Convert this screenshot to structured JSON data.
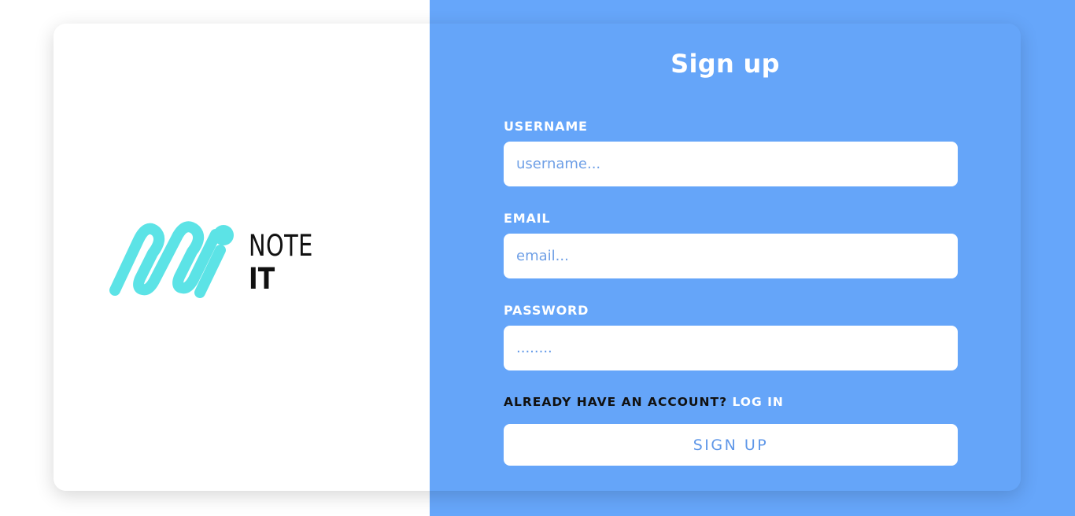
{
  "logo": {
    "word_top": "NOTE",
    "word_bottom": "IT",
    "accent_color": "#5ce3e6"
  },
  "signup": {
    "title": "Sign up",
    "username_label": "USERNAME",
    "username_placeholder": "username...",
    "email_label": "EMAIL",
    "email_placeholder": "email...",
    "password_label": "PASSWORD",
    "password_value": "........",
    "account_prompt": "ALREADY HAVE AN ACCOUNT?",
    "login_link": "LOG IN",
    "submit_label": "SIGN UP"
  },
  "colors": {
    "panel_blue": "#65a5f9",
    "white": "#ffffff"
  }
}
